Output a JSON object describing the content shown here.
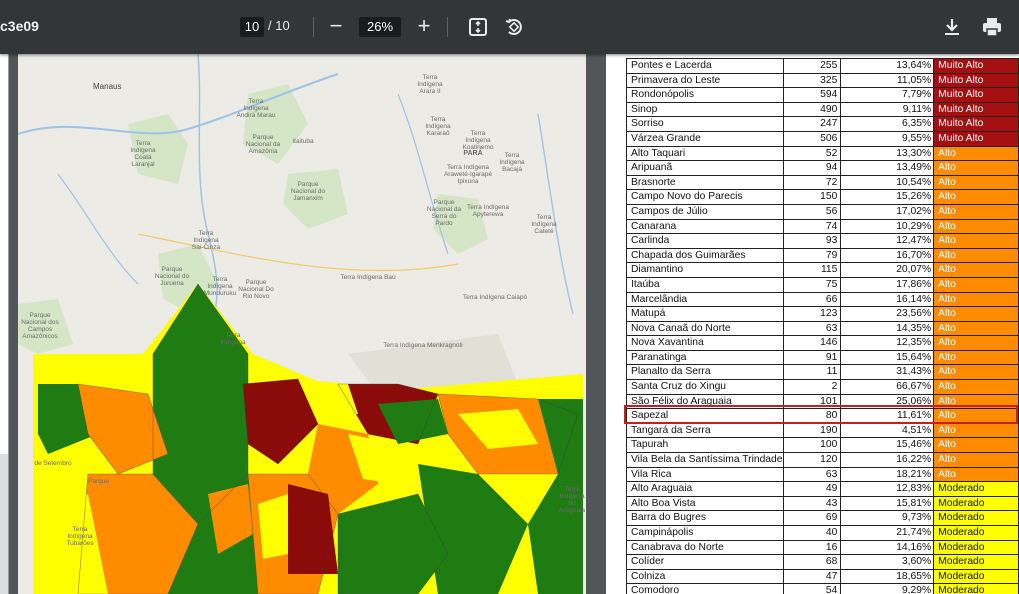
{
  "toolbar": {
    "doc_title": "c3e09",
    "current_page": "10",
    "total_pages": "/ 10",
    "zoom_out_label": "−",
    "zoom_level": "26%",
    "zoom_in_label": "+",
    "icons": [
      "fit-page-icon",
      "rotate-icon",
      "download-icon",
      "print-icon"
    ]
  },
  "map": {
    "labels": [
      {
        "text": "Manaus"
      },
      {
        "text": "Parque Nacional da Amazônia"
      },
      {
        "text": "Itaituba"
      },
      {
        "text": "Terra Indígena Coatá Laranjal"
      },
      {
        "text": "Terra Indígena Andirá Marau"
      },
      {
        "text": "Terra Indígena Arara II"
      },
      {
        "text": "PARÁ"
      },
      {
        "text": "Terra Indígena Koatinemo"
      },
      {
        "text": "Terra Indígena Bacajá"
      },
      {
        "text": "Terra Indígena Kararaô"
      },
      {
        "text": "Terra Indígena Araweté-Igarapé Ipixuna"
      },
      {
        "text": "Parque Nacional do Jamanxim"
      },
      {
        "text": "Parque Nacional da Serra do Pardo"
      },
      {
        "text": "Terra Indígena Apyterewa"
      },
      {
        "text": "Terra Indígena Cateté"
      },
      {
        "text": "Terra Indígena Sai-Cinza"
      },
      {
        "text": "Parque Nacional do Juruena"
      },
      {
        "text": "Terra Indígena Munduruku"
      },
      {
        "text": "Parque Nacional Do Rio Novo"
      },
      {
        "text": "Terra Indígena Baú"
      },
      {
        "text": "Terra Indígena Caiapó"
      },
      {
        "text": "Parque Nacional dos Campos Amazônicos"
      },
      {
        "text": "Terra Indígena"
      },
      {
        "text": "Terra Indígena Menkragnoti"
      },
      {
        "text": "de Setembro"
      },
      {
        "text": "Parque"
      },
      {
        "text": "Terra Indígena Tubarões"
      },
      {
        "text": "Terra Indígena do Araguaia"
      }
    ]
  },
  "table": {
    "rows": [
      {
        "name": "Pontes e Lacerda",
        "num": "255",
        "pct": "13,64%",
        "cls": "Muito Alto"
      },
      {
        "name": "Primavera do Leste",
        "num": "325",
        "pct": "11,05%",
        "cls": "Muito Alto"
      },
      {
        "name": "Rondonópolis",
        "num": "594",
        "pct": "7,79%",
        "cls": "Muito Alto"
      },
      {
        "name": "Sinop",
        "num": "490",
        "pct": "9,11%",
        "cls": "Muito Alto"
      },
      {
        "name": "Sorriso",
        "num": "247",
        "pct": "6,35%",
        "cls": "Muito Alto"
      },
      {
        "name": "Várzea Grande",
        "num": "506",
        "pct": "9,55%",
        "cls": "Muito Alto"
      },
      {
        "name": "Alto Taquari",
        "num": "52",
        "pct": "13,30%",
        "cls": "Alto"
      },
      {
        "name": "Aripuanã",
        "num": "94",
        "pct": "13,49%",
        "cls": "Alto"
      },
      {
        "name": "Brasnorte",
        "num": "72",
        "pct": "10,54%",
        "cls": "Alto"
      },
      {
        "name": "Campo Novo do Parecis",
        "num": "150",
        "pct": "15,26%",
        "cls": "Alto"
      },
      {
        "name": "Campos de Júlio",
        "num": "56",
        "pct": "17,02%",
        "cls": "Alto"
      },
      {
        "name": "Canarana",
        "num": "74",
        "pct": "10,29%",
        "cls": "Alto"
      },
      {
        "name": "Carlinda",
        "num": "93",
        "pct": "12,47%",
        "cls": "Alto"
      },
      {
        "name": "Chapada dos Guimarães",
        "num": "79",
        "pct": "16,70%",
        "cls": "Alto"
      },
      {
        "name": "Diamantino",
        "num": "115",
        "pct": "20,07%",
        "cls": "Alto"
      },
      {
        "name": "Itaúba",
        "num": "75",
        "pct": "17,86%",
        "cls": "Alto"
      },
      {
        "name": "Marcelândia",
        "num": "66",
        "pct": "16,14%",
        "cls": "Alto"
      },
      {
        "name": "Matupá",
        "num": "123",
        "pct": "23,56%",
        "cls": "Alto"
      },
      {
        "name": "Nova Canaã do Norte",
        "num": "63",
        "pct": "14,35%",
        "cls": "Alto"
      },
      {
        "name": "Nova Xavantina",
        "num": "146",
        "pct": "12,35%",
        "cls": "Alto"
      },
      {
        "name": "Paranatinga",
        "num": "91",
        "pct": "15,64%",
        "cls": "Alto"
      },
      {
        "name": "Planalto da Serra",
        "num": "11",
        "pct": "31,43%",
        "cls": "Alto"
      },
      {
        "name": "Santa Cruz do Xingu",
        "num": "2",
        "pct": "66,67%",
        "cls": "Alto"
      },
      {
        "name": "São Félix do Araguaia",
        "num": "101",
        "pct": "25,06%",
        "cls": "Alto"
      },
      {
        "name": "Sapezal",
        "num": "80",
        "pct": "11,61%",
        "cls": "Alto"
      },
      {
        "name": "Tangará da Serra",
        "num": "190",
        "pct": "4,51%",
        "cls": "Alto"
      },
      {
        "name": "Tapurah",
        "num": "100",
        "pct": "15,46%",
        "cls": "Alto"
      },
      {
        "name": "Vila Bela da Santíssima Trindade",
        "num": "120",
        "pct": "16,22%",
        "cls": "Alto"
      },
      {
        "name": "Vila Rica",
        "num": "63",
        "pct": "18,21%",
        "cls": "Alto"
      },
      {
        "name": "Alto Araguaia",
        "num": "49",
        "pct": "12,83%",
        "cls": "Moderado"
      },
      {
        "name": "Alto Boa Vista",
        "num": "43",
        "pct": "15,81%",
        "cls": "Moderado"
      },
      {
        "name": "Barra do Bugres",
        "num": "69",
        "pct": "9,73%",
        "cls": "Moderado"
      },
      {
        "name": "Campinápolis",
        "num": "40",
        "pct": "21,74%",
        "cls": "Moderado"
      },
      {
        "name": "Canabrava do Norte",
        "num": "16",
        "pct": "14,16%",
        "cls": "Moderado"
      },
      {
        "name": "Colíder",
        "num": "68",
        "pct": "3,60%",
        "cls": "Moderado"
      },
      {
        "name": "Colniza",
        "num": "47",
        "pct": "18,65%",
        "cls": "Moderado"
      },
      {
        "name": "Comodoro",
        "num": "54",
        "pct": "9,29%",
        "cls": "Moderado"
      }
    ],
    "highlighted_row": "Sapezal",
    "class_colors": {
      "Muito Alto": "#a50f0f",
      "Alto": "#ff8c00",
      "Moderado": "#ffff00"
    }
  }
}
